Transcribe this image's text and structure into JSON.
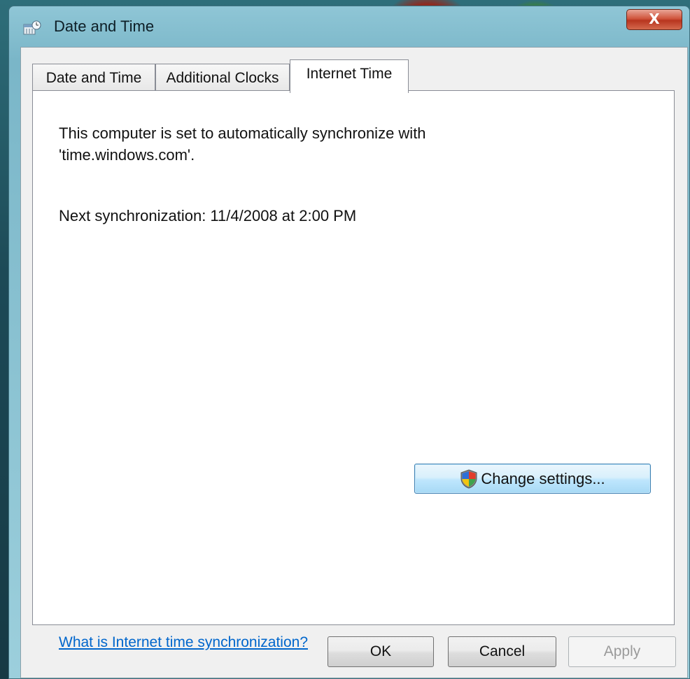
{
  "window": {
    "title": "Date and Time",
    "close_label": "X"
  },
  "tabs": [
    {
      "label": "Date and Time",
      "active": false
    },
    {
      "label": "Additional Clocks",
      "active": false
    },
    {
      "label": "Internet Time",
      "active": true
    }
  ],
  "panel": {
    "sync_text_line1": "This computer is set to automatically synchronize with",
    "sync_text_line2": "'time.windows.com'.",
    "next_sync": "Next synchronization: 11/4/2008 at 2:00 PM",
    "change_settings_label": "Change settings...",
    "help_link": "What is Internet time synchronization?"
  },
  "buttons": {
    "ok": "OK",
    "cancel": "Cancel",
    "apply": "Apply"
  },
  "colors": {
    "link": "#0066cc",
    "close_button": "#c9452b",
    "active_button": "#bee6fd"
  },
  "icons": {
    "title": "date-time-icon",
    "uac": "uac-shield-icon"
  }
}
